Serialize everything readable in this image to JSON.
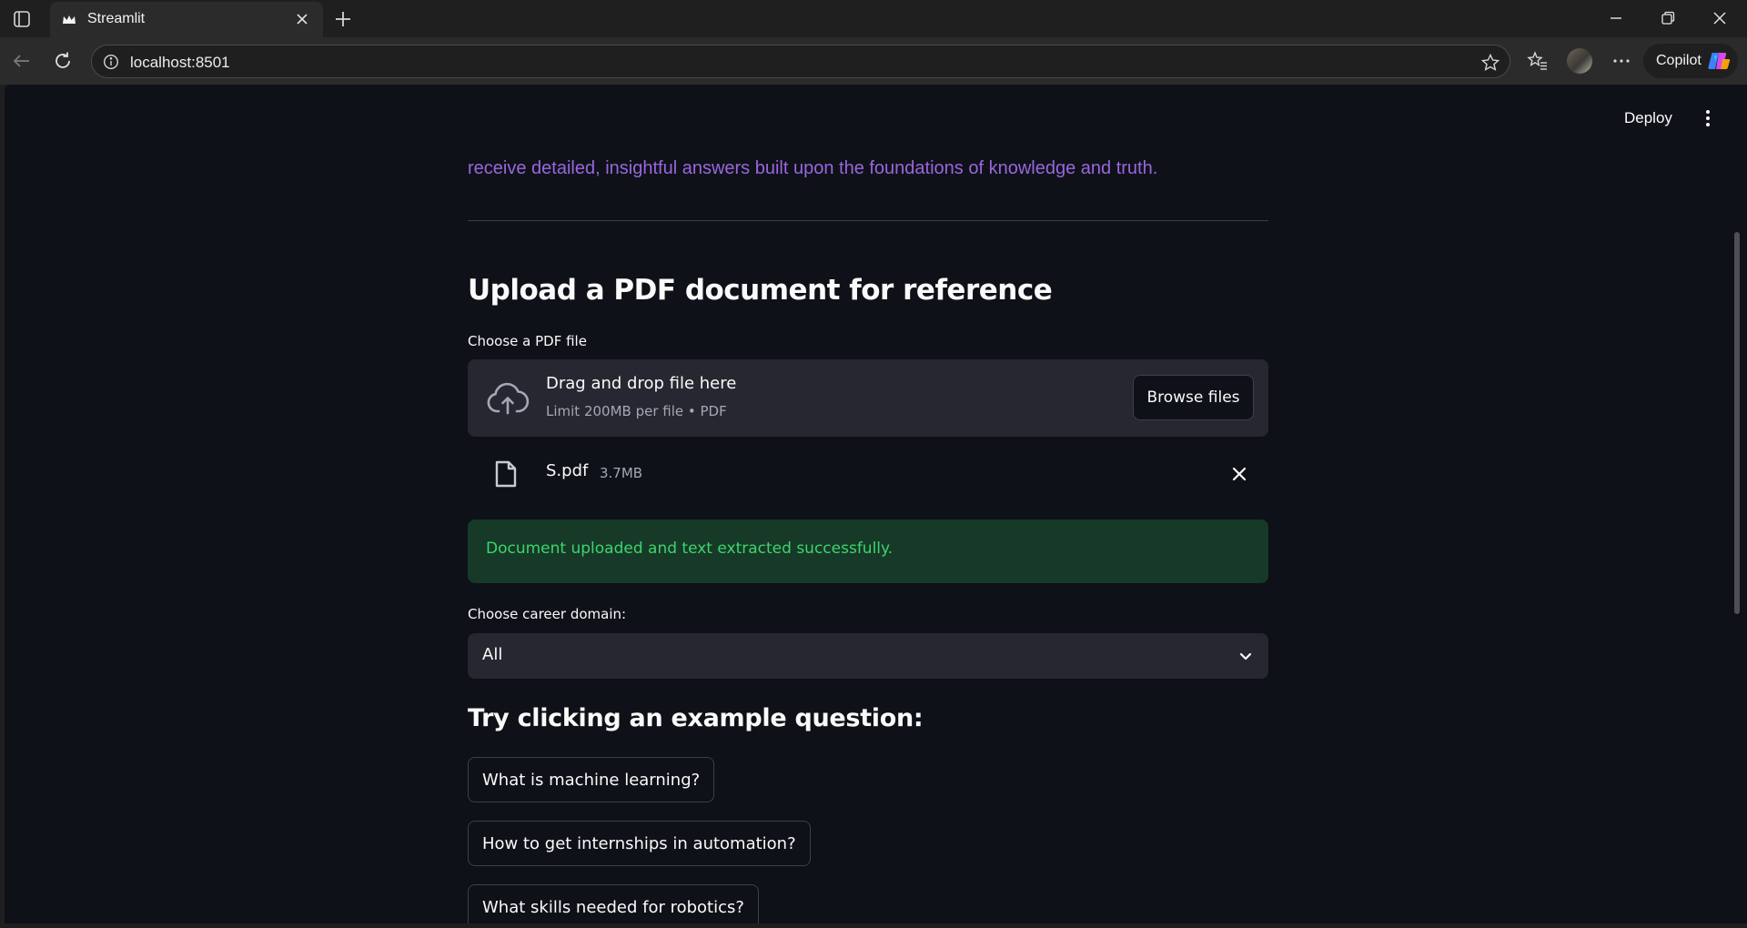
{
  "browser": {
    "tab_title": "Streamlit",
    "url": "localhost:8501",
    "copilot_label": "Copilot"
  },
  "header": {
    "deploy_label": "Deploy"
  },
  "main": {
    "intro_text": "receive detailed, insightful answers built upon the foundations of knowledge and truth.",
    "upload_heading": "Upload a PDF document for reference",
    "uploader": {
      "label": "Choose a PDF file",
      "drag_text": "Drag and drop file here",
      "limit_text": "Limit 200MB per file • PDF",
      "browse_label": "Browse files"
    },
    "uploaded_file": {
      "name": "S.pdf",
      "size": "3.7MB"
    },
    "success_message": "Document uploaded and text extracted successfully.",
    "domain_select": {
      "label": "Choose career domain:",
      "value": "All"
    },
    "examples_heading": "Try clicking an example question:",
    "example_questions": [
      "What is machine learning?",
      "How to get internships in automation?",
      "What skills needed for robotics?"
    ]
  },
  "colors": {
    "app_background": "#0e1117",
    "accent_purple": "#9966e0",
    "success_bg": "#173928",
    "success_text": "#3dd56d",
    "widget_bg": "#262730"
  }
}
